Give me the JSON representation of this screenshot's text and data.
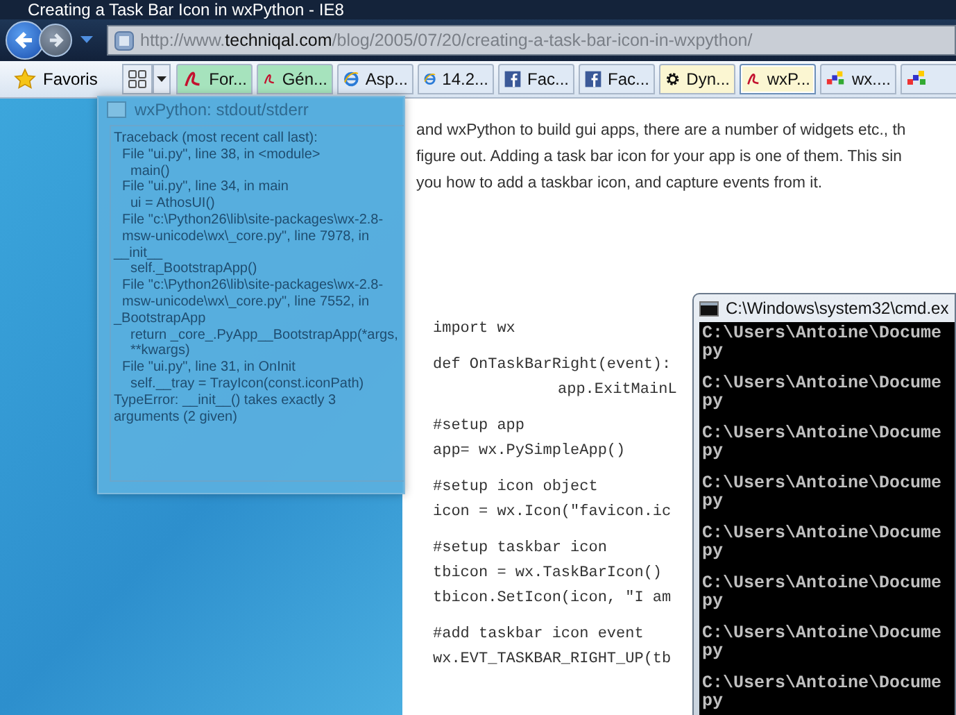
{
  "window": {
    "title": "Creating a Task Bar Icon in wxPython - IE8"
  },
  "address_bar": {
    "url": "http://www.**techniqal.com**/blog/2005/07/20/creating-a-task-bar-icon-in-wxpython/"
  },
  "favorites_bar": {
    "label": "Favoris"
  },
  "tabs": [
    {
      "label": "For...",
      "kind": "pdf",
      "color": "#a6e3bd",
      "selected": false
    },
    {
      "label": "Gén...",
      "kind": "pdf",
      "color": "#a6e3bd",
      "selected": false
    },
    {
      "label": "Asp...",
      "kind": "ie",
      "color": "#dfe9f5",
      "selected": false
    },
    {
      "label": "14.2...",
      "kind": "ie",
      "color": "#dfe9f5",
      "selected": false
    },
    {
      "label": "Fac...",
      "kind": "facebook",
      "color": "#dfe9f5",
      "selected": false
    },
    {
      "label": "Fac...",
      "kind": "facebook",
      "color": "#dfe9f5",
      "selected": false
    },
    {
      "label": "Dyn...",
      "kind": "gear",
      "color": "#fbf6d2",
      "selected": false
    },
    {
      "label": "wxP...",
      "kind": "pdf",
      "color": "#fbf6d2",
      "selected": true
    },
    {
      "label": "wx....",
      "kind": "wx",
      "color": "#dfe9f5",
      "selected": false
    },
    {
      "kind": "wx",
      "color": "#dfe9f5",
      "selected": false
    }
  ],
  "article": {
    "paragraph_lines": [
      "and wxPython to build gui apps, there are a number of widgets etc., th",
      "figure out. Adding a task bar icon for your app is one of them. This sin",
      "you how to add a taskbar icon, and capture events from it."
    ],
    "code_blocks": [
      {
        "lines": [
          "import wx"
        ]
      },
      {
        "lines": [
          "def OnTaskBarRight(event):"
        ],
        "body": [
          "app.ExitMainL"
        ]
      },
      {
        "lines": [
          "#setup app",
          "app= wx.PySimpleApp()"
        ]
      },
      {
        "lines": [
          "#setup icon object",
          "icon = wx.Icon(\"favicon.ic"
        ]
      },
      {
        "lines": [
          "#setup taskbar icon",
          "tbicon = wx.TaskBarIcon()",
          "tbicon.SetIcon(icon, \"I am"
        ]
      },
      {
        "lines": [
          "#add taskbar icon event",
          "wx.EVT_TASKBAR_RIGHT_UP(tb"
        ]
      }
    ]
  },
  "stderr_window": {
    "title": "wxPython: stdout/stderr",
    "lines": [
      {
        "kind": "heading",
        "text": "Traceback (most recent call last):"
      },
      {
        "kind": "frame",
        "text": "File \"ui.py\", line 38, in <module>"
      },
      {
        "kind": "source",
        "text": "main()"
      },
      {
        "kind": "frame",
        "text": "File \"ui.py\", line 34, in main"
      },
      {
        "kind": "source",
        "text": "ui = AthosUI()"
      },
      {
        "kind": "frame",
        "text": "File \"c:\\Python26\\lib\\site-packages\\wx-2.8-msw-unicode\\wx\\_core.py\", line 7978, in"
      },
      {
        "kind": "wrap",
        "text": "__init__"
      },
      {
        "kind": "source",
        "text": "self._BootstrapApp()"
      },
      {
        "kind": "frame",
        "text": "File \"c:\\Python26\\lib\\site-packages\\wx-2.8-msw-unicode\\wx\\_core.py\", line 7552, in"
      },
      {
        "kind": "wrap",
        "text": "_BootstrapApp"
      },
      {
        "kind": "source",
        "text": "return _core_.PyApp__BootstrapApp(*args, **kwargs)"
      },
      {
        "kind": "frame",
        "text": "File \"ui.py\", line 31, in OnInit"
      },
      {
        "kind": "source",
        "text": "self.__tray = TrayIcon(const.iconPath)"
      },
      {
        "kind": "heading",
        "text": "TypeError: __init__() takes exactly 3 arguments (2 given)"
      }
    ]
  },
  "cmd_window": {
    "title": "C:\\Windows\\system32\\cmd.ex",
    "entries": [
      {
        "path": "C:\\Users\\Antoine\\Docume",
        "continuation": "py"
      },
      {
        "path": "C:\\Users\\Antoine\\Docume",
        "continuation": "py"
      },
      {
        "path": "C:\\Users\\Antoine\\Docume",
        "continuation": "py"
      },
      {
        "path": "C:\\Users\\Antoine\\Docume",
        "continuation": "py"
      },
      {
        "path": "C:\\Users\\Antoine\\Docume",
        "continuation": "py"
      },
      {
        "path": "C:\\Users\\Antoine\\Docume",
        "continuation": "py"
      },
      {
        "path": "C:\\Users\\Antoine\\Docume",
        "continuation": "py"
      },
      {
        "path": "C:\\Users\\Antoine\\Docume",
        "continuation": "py"
      }
    ]
  }
}
